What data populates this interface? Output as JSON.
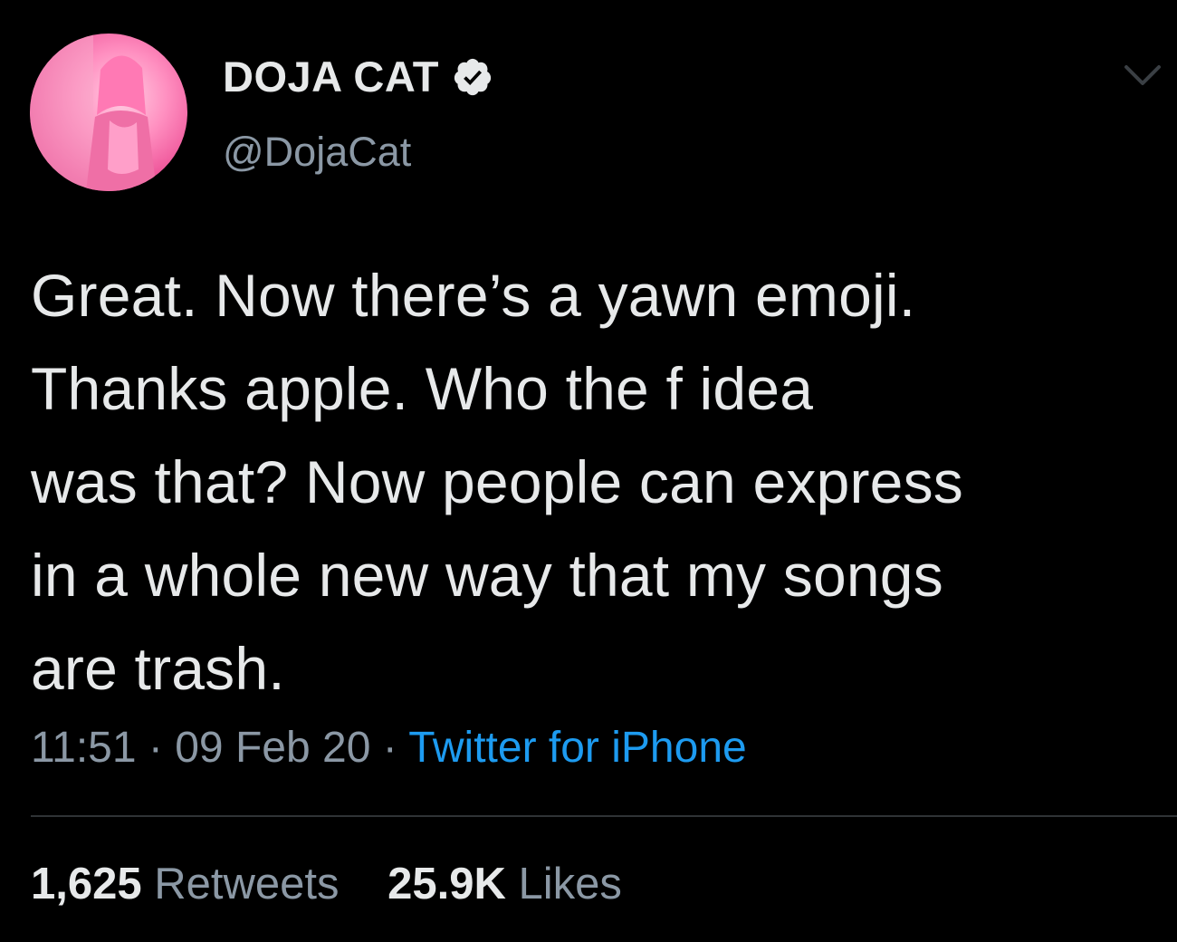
{
  "author": {
    "display_name": "DOJA CAT",
    "handle": "@DojaCat",
    "verified_icon": "verified-badge-icon"
  },
  "tweet": {
    "text": "Great. Now there’s a yawn emoji.\nThanks apple. Who the f        idea\nwas that? Now people can express\nin a whole new way that my songs\nare trash."
  },
  "meta": {
    "time": "11:51",
    "separator": "·",
    "date": "09 Feb 20",
    "source": "Twitter for iPhone"
  },
  "stats": {
    "retweets_count": "1,625",
    "retweets_label": "Retweets",
    "likes_count": "25.9K",
    "likes_label": "Likes"
  },
  "colors": {
    "background": "#000000",
    "text": "#e7e9ea",
    "secondary": "#8b98a5",
    "link": "#1d9bf0",
    "divider": "#2f3336"
  }
}
